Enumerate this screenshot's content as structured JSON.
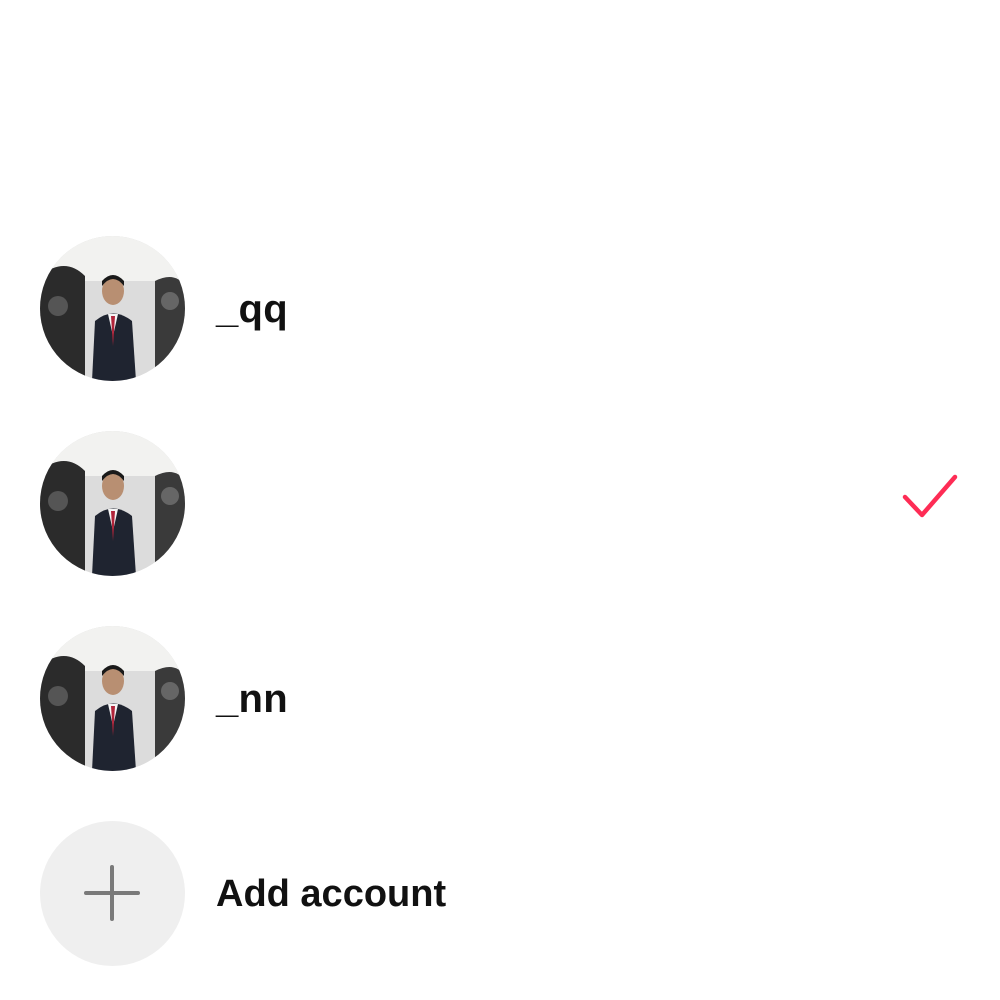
{
  "accounts": [
    {
      "username": "_qq",
      "selected": false,
      "avatar": "profile-photo-man-in-suit"
    },
    {
      "username": "",
      "selected": true,
      "avatar": "profile-photo-man-in-suit"
    },
    {
      "username": "_nn",
      "selected": false,
      "avatar": "profile-photo-man-in-suit"
    }
  ],
  "add_account": {
    "label": "Add account",
    "icon": "plus-icon"
  },
  "colors": {
    "check": "#fe2c55",
    "add_circle_bg": "#efefef",
    "plus": "#7a7a7a",
    "text": "#111111"
  }
}
